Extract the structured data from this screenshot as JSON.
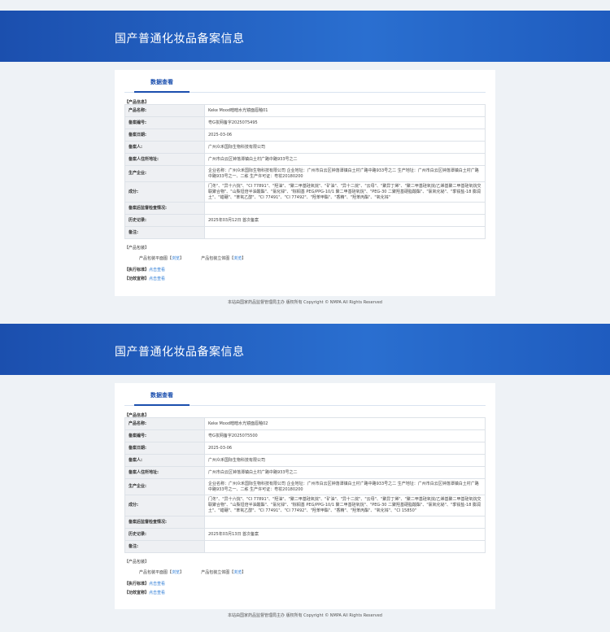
{
  "records": [
    {
      "banner_title": "国产普通化妆品备案信息",
      "tab_label": "数据查看",
      "product_info_label": "【产品信息】",
      "rows": [
        {
          "key": "产品名称:",
          "value": "Keke Mood暗暗水光镜面唇釉01"
        },
        {
          "key": "备案编号:",
          "value": "粤G妆网备字2025075495"
        },
        {
          "key": "备案日期:",
          "value": "2025-03-06"
        },
        {
          "key": "备案人:",
          "value": "广州众禾国际生物科技有限公司"
        },
        {
          "key": "备案人住所地址:",
          "value": "广州市白云区钟落潭镇白土村广路中路933号之二"
        },
        {
          "key": "生产企业:",
          "value": "企业名称：广州众禾国际生物科技有限公司 企业地址：广州市白云区钟落潭镇白土村广路中路933号之二 生产地址：广州市白云区钟落潭镇白土村广路中路933号之一、二栋 生产许可证：粤妆20180200"
        },
        {
          "key": "成分:",
          "value": "门冬\"、\"异十六烷\"、\"CI 77891\"、\"羟油\"、\"聚二甲基硅氧烷\"、\"矿油\"、\"异十二烷\"、\"云母\"、\"聚异丁烯\"、\"聚二甲基硅氧烷/乙烯基聚二甲基硅氧烷交联聚合物\"、\"山梨坦倍半油酸酯\"、\"氯化锌\"、\"棕榈基 PEG/PPG-10/1 聚二甲基硅氧烷\"、\"PEG-30 二聚羟基硬脂酸酯\"、\"氯氧化铋\"、\"季铵盐-18 膨润土\"、\"蜡硼\"、\"苯氧乙醇\"、\"CI 77491\"、\"CI 77492\"、\"羟苯甲酯\"、\"香精\"、\"羟苯丙酯\"、\"氧化锌\""
        },
        {
          "key": "备案后监督检查情况:",
          "value": ""
        },
        {
          "key": "历史记录:",
          "value": "2025年03月12日 首次备案"
        },
        {
          "key": "备注:",
          "value": ""
        }
      ],
      "pkg_label": "【产品包装】",
      "pkg_items": [
        {
          "name": "产品包装平面图",
          "bracket_l": "【",
          "link": "浏览",
          "bracket_r": "】"
        },
        {
          "name": "产品包装立体图",
          "bracket_l": "【",
          "link": "浏览",
          "bracket_r": "】"
        }
      ],
      "std_label": "【执行标准】",
      "std_link": "点击查看",
      "eff_label": "【功效宣称】",
      "eff_link": "点击查看",
      "footer": "本站由国家药品监督管理局主办 版权所有 Copyright © NMPA All Rights Reserved"
    },
    {
      "banner_title": "国产普通化妆品备案信息",
      "tab_label": "数据查看",
      "product_info_label": "【产品信息】",
      "rows": [
        {
          "key": "产品名称:",
          "value": "Keke Mood暗暗水光镜面唇釉02"
        },
        {
          "key": "备案编号:",
          "value": "粤G妆网备字2025075500"
        },
        {
          "key": "备案日期:",
          "value": "2025-03-06"
        },
        {
          "key": "备案人:",
          "value": "广州众禾国际生物科技有限公司"
        },
        {
          "key": "备案人住所地址:",
          "value": "广州市白云区钟落潭镇白土村广路中路933号之二"
        },
        {
          "key": "生产企业:",
          "value": "企业名称：广州众禾国际生物科技有限公司 企业地址：广州市白云区钟落潭镇白土村广路中路933号之二 生产地址：广州市白云区钟落潭镇白土村广路中路933号之一、二栋 生产许可证：粤妆20180200"
        },
        {
          "key": "成分:",
          "value": "门冬\"、\"异十六烷\"、\"CI 77891\"、\"羟油\"、\"聚二甲基硅氧烷\"、\"矿油\"、\"异十二烷\"、\"云母\"、\"聚异丁烯\"、\"聚二甲基硅氧烷/乙烯基聚二甲基硅氧烷交联聚合物\"、\"山梨坦倍半油酸酯\"、\"氯化锌\"、\"棕榈基 PEG/PPG-10/1 聚二甲基硅氧烷\"、\"PEG-30 二聚羟基硬脂酸酯\"、\"氯氧化铋\"、\"季铵盐-18 膨润土\"、\"蜡硼\"、\"苯氧乙醇\"、\"CI 77491\"、\"CI 77492\"、\"羟苯甲酯\"、\"香精\"、\"羟苯丙酯\"、\"氧化锌\"、\"CI 15850\""
        },
        {
          "key": "备案后监督检查情况:",
          "value": ""
        },
        {
          "key": "历史记录:",
          "value": "2025年03月13日 首次备案"
        },
        {
          "key": "备注:",
          "value": ""
        }
      ],
      "pkg_label": "【产品包装】",
      "pkg_items": [
        {
          "name": "产品包装平面图",
          "bracket_l": "【",
          "link": "浏览",
          "bracket_r": "】"
        },
        {
          "name": "产品包装立体图",
          "bracket_l": "【",
          "link": "浏览",
          "bracket_r": "】"
        }
      ],
      "std_label": "【执行标准】",
      "std_link": "点击查看",
      "eff_label": "【功效宣称】",
      "eff_link": "点击查看",
      "footer": "本站由国家药品监督管理局主办 版权所有 Copyright © NMPA All Rights Reserved"
    }
  ]
}
